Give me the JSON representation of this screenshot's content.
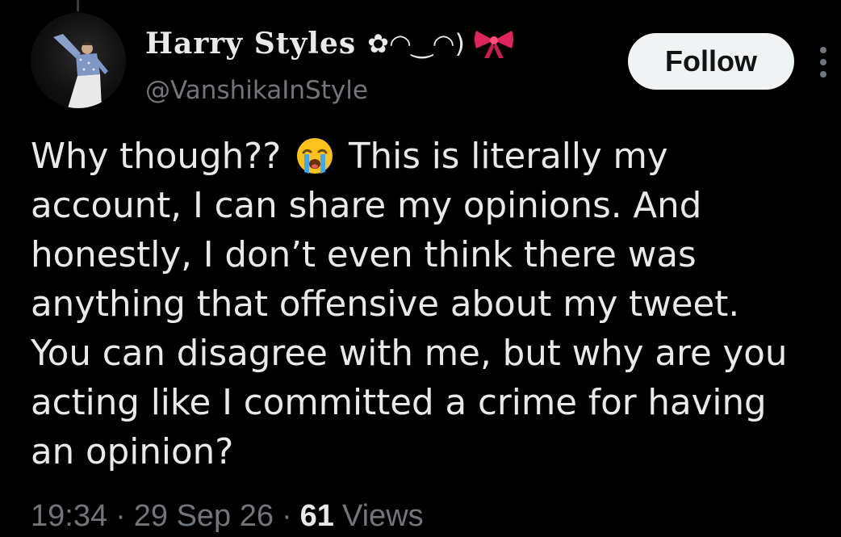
{
  "author": {
    "display_name": "Harry Styles",
    "name_suffix": "✿◠‿◠)",
    "bow_icon": "ribbon-bow-icon",
    "handle": "@VanshikaInStyle",
    "avatar_icon": "profile-avatar"
  },
  "actions": {
    "follow_label": "Follow",
    "more_icon": "more-vertical-icon"
  },
  "tweet": {
    "lines": [
      {
        "before": "Why though??",
        "emoji": "loudly-crying-face-emoji",
        "after": "This is literally my"
      },
      "account, I can share my opinions. And",
      "honestly, I don’t even think there was",
      "anything that offensive about my tweet.",
      "You can disagree with me, but why are you",
      "acting like I committed a crime for having",
      "an opinion?"
    ]
  },
  "meta": {
    "time": "19:34",
    "separator": "·",
    "date": "29 Sep 26",
    "views_count": "61",
    "views_label": "Views"
  },
  "colors": {
    "background": "#000000",
    "text_primary": "#e7e9ea",
    "text_secondary": "#71767b",
    "follow_bg": "#eff3f4",
    "follow_text": "#0f1419",
    "bow": "#e0245e"
  }
}
